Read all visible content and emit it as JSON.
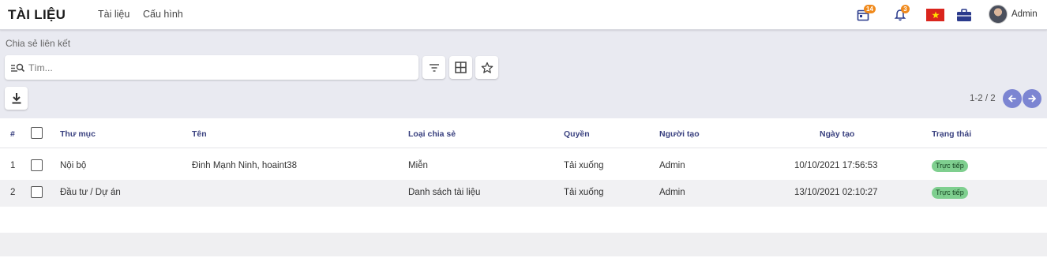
{
  "header": {
    "app_title": "TÀI LIỆU",
    "nav": [
      {
        "label": "Tài liệu"
      },
      {
        "label": "Cấu hình"
      }
    ],
    "calendar_badge": "14",
    "notification_badge": "3",
    "user_name": "Admin"
  },
  "breadcrumb": "Chia sẻ liên kết",
  "search": {
    "placeholder": "Tìm...",
    "value": ""
  },
  "pager": {
    "range": "1-2 / 2"
  },
  "table": {
    "columns": [
      "#",
      "Thư mục",
      "Tên",
      "Loại chia sẻ",
      "Quyền",
      "Người tạo",
      "Ngày tạo",
      "Trạng thái"
    ],
    "rows": [
      {
        "index": "1",
        "folder": "Nội bộ",
        "name": "Đinh Mạnh Ninh, hoaint38",
        "share_type": "Miễn",
        "permission": "Tải xuống",
        "creator": "Admin",
        "created": "10/10/2021 17:56:53",
        "status": "Trực tiếp"
      },
      {
        "index": "2",
        "folder": "Đầu tư / Dự án",
        "name": "",
        "share_type": "Danh sách tài liệu",
        "permission": "Tải xuống",
        "creator": "Admin",
        "created": "13/10/2021 02:10:27",
        "status": "Trực tiếp"
      }
    ]
  },
  "colors": {
    "accent": "#7c85d2",
    "status_green": "#7fcf8f",
    "header_text": "#3b4280",
    "badge": "#f08a1c"
  }
}
